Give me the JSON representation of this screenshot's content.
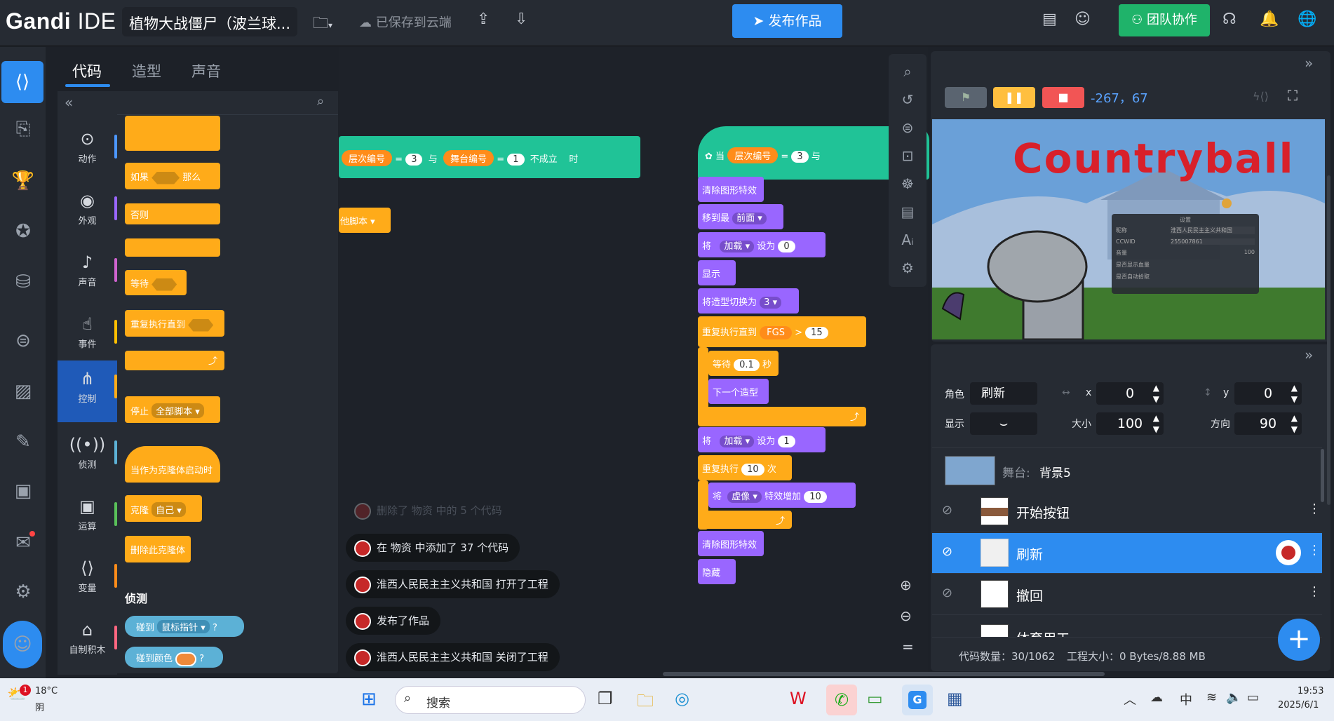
{
  "header": {
    "logo_main": "Gandi",
    "logo_sub": "IDE",
    "project_name": "植物大战僵尸（波兰球...",
    "save_status": "已保存到云端",
    "publish_label": "发布作品",
    "team_label": "团队协作"
  },
  "tabs": [
    "代码",
    "造型",
    "声音"
  ],
  "categories": [
    {
      "label": "动作",
      "icon": "⊙",
      "color": "#4c97ff"
    },
    {
      "label": "外观",
      "icon": "◉",
      "color": "#9966ff"
    },
    {
      "label": "声音",
      "icon": "♪",
      "color": "#cf63cf"
    },
    {
      "label": "事件",
      "icon": "☝",
      "color": "#ffbf00"
    },
    {
      "label": "控制",
      "icon": "⋔",
      "color": "#ffab19"
    },
    {
      "label": "侦测",
      "icon": "((•))",
      "color": "#5cb1d6"
    },
    {
      "label": "运算",
      "icon": "▣",
      "color": "#59c059"
    },
    {
      "label": "变量",
      "icon": "⟨⟩",
      "color": "#ff8c1a"
    },
    {
      "label": "自制积木",
      "icon": "⌂",
      "color": "#ff6680"
    }
  ],
  "palette": {
    "if_label": "如果",
    "then_label": "那么",
    "else_label": "否则",
    "wait_label": "等待",
    "repeat_until_label": "重复执行直到",
    "stop_label": "停止",
    "stop_option": "全部脚本",
    "clone_start_label": "当作为克隆体启动时",
    "clone_label": "克隆",
    "clone_option": "自己",
    "delete_clone_label": "删除此克隆体",
    "sensing_heading": "侦测",
    "touching_label": "碰到",
    "touching_option": "鼠标指针",
    "touching_color_label": "碰到颜色",
    "question": "?"
  },
  "workspace": {
    "left_cond": {
      "var": "层次编号",
      "eq": "=",
      "v1": "3",
      "and": "与",
      "var2": "舞台编号",
      "v2": "1",
      "not": "不成立",
      "when": "时"
    },
    "left_partial": "他脚本",
    "right_hat": {
      "when": "当",
      "var": "层次编号",
      "eq": "=",
      "v1": "3",
      "and": "与"
    },
    "script": {
      "clear_effects": "清除图形特效",
      "move_to": "移到最",
      "front": "前面",
      "set": "将",
      "loading": "加载",
      "set_to": "设为",
      "v0": "0",
      "show": "显示",
      "switch_costume": "将造型切换为",
      "costume_num": "3",
      "repeat_until": "重复执行直到",
      "fgs": "FGS",
      "gt": ">",
      "fgs_value": "15",
      "wait": "等待",
      "wait_value": "0.1",
      "sec": "秒",
      "next_costume": "下一个造型",
      "set_value": "1",
      "repeat": "重复执行",
      "repeat_count": "10",
      "times": "次",
      "ghost": "虚像",
      "effect_add": "特效增加",
      "effect_value": "10",
      "clear_effects2": "清除图形特效",
      "hide": "隐藏"
    }
  },
  "logs": [
    "删除了 物资 中的 5 个代码",
    "在 物资 中添加了 37 个代码",
    "淮西人民民主主义共和国 打开了工程",
    "发布了作品",
    "淮西人民民主主义共和国 关闭了工程"
  ],
  "stage": {
    "coords": "-267，67",
    "title_text": "Countryball",
    "settings_title": "设置",
    "settings_rows": [
      {
        "label": "昵称",
        "value": "淮西人民民主主义共和国"
      },
      {
        "label": "CCWID",
        "value": "255007861"
      },
      {
        "label": "音量",
        "value": "100"
      },
      {
        "label": "是否显示血量",
        "value": ""
      },
      {
        "label": "是否自动拾取",
        "value": ""
      }
    ]
  },
  "sprite_info": {
    "role_label": "角色",
    "role_name": "刷新",
    "x_label": "x",
    "x": "0",
    "y_label": "y",
    "y": "0",
    "show_label": "显示",
    "size_label": "大小",
    "size": "100",
    "dir_label": "方向",
    "dir": "90"
  },
  "stage_row": {
    "label": "舞台:",
    "name": "背景5"
  },
  "sprites": [
    {
      "name": "开始按钮",
      "selected": false
    },
    {
      "name": "刷新",
      "selected": true
    },
    {
      "name": "撤回",
      "selected": false
    },
    {
      "name": "体育用工",
      "selected": false
    }
  ],
  "footer": {
    "code_count": "代码数量：30/1062",
    "project_size": "工程大小：0 Bytes/8.88 MB"
  },
  "taskbar": {
    "temp": "18°C",
    "weather": "阴",
    "badge": "1",
    "search": "搜索",
    "ime": "中",
    "time": "19:53",
    "date": "2025/6/1"
  }
}
